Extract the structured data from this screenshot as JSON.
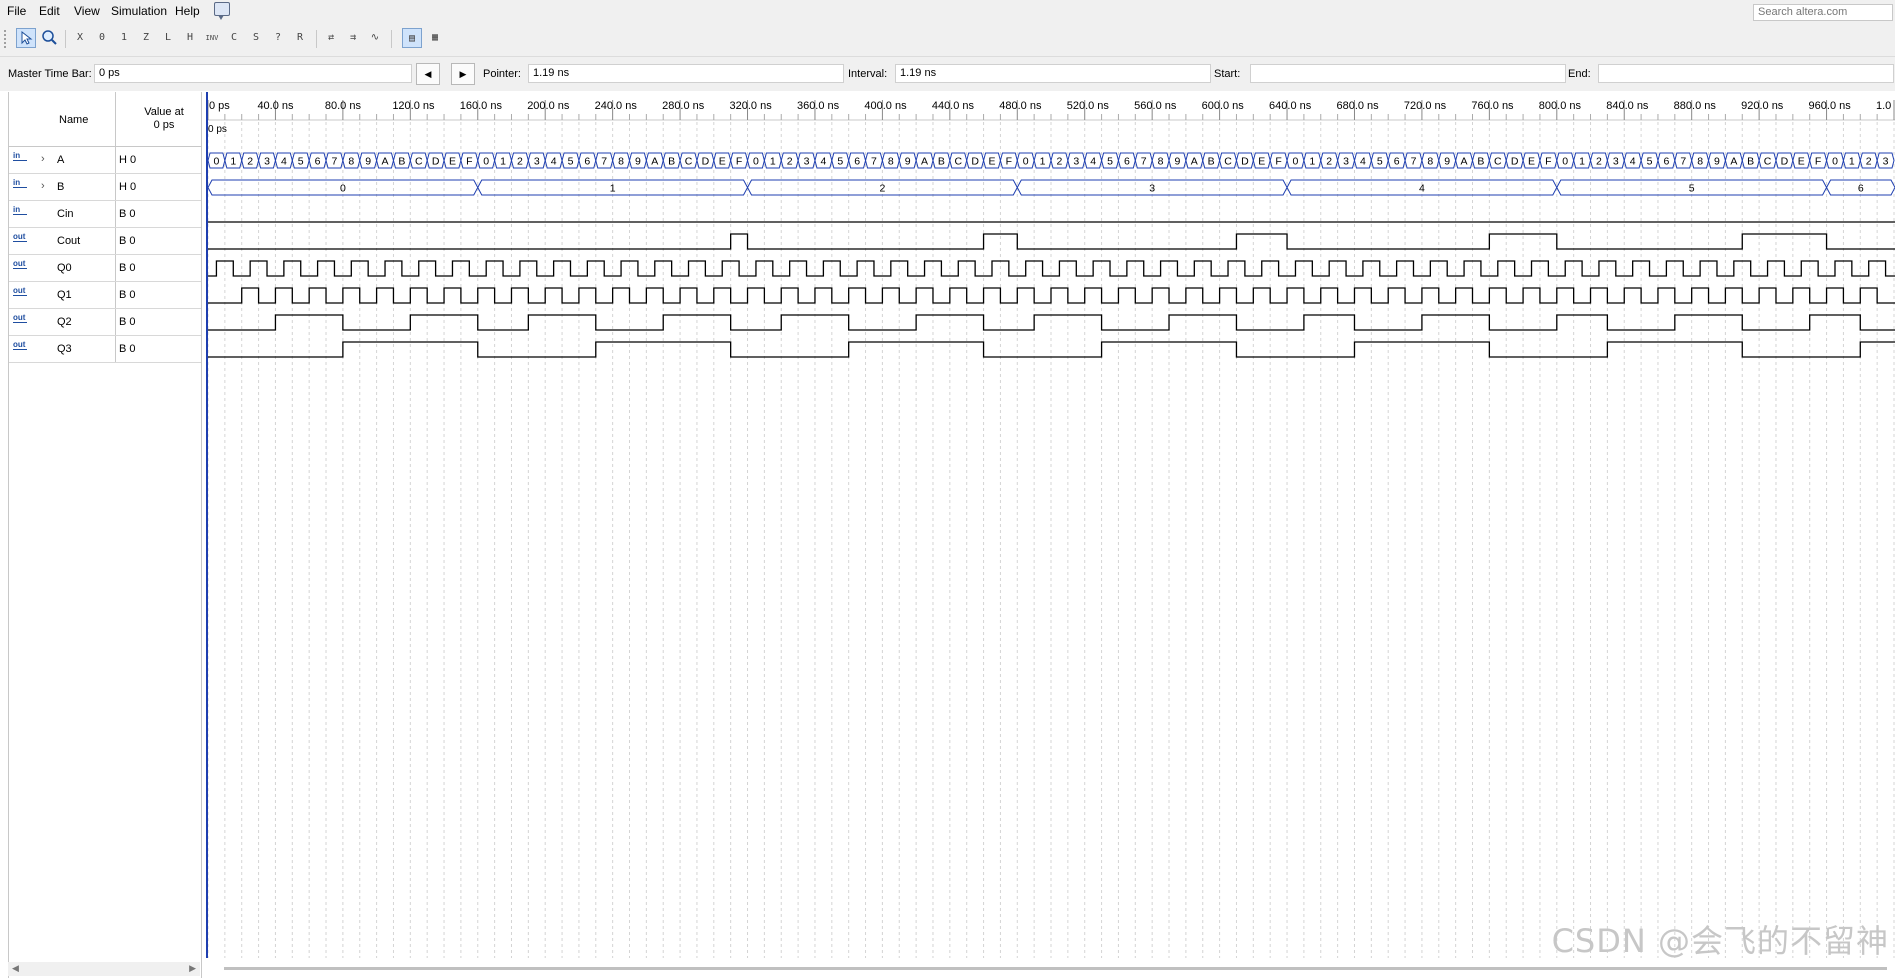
{
  "menu": {
    "file": "File",
    "edit": "Edit",
    "view": "View",
    "simulation": "Simulation",
    "help": "Help"
  },
  "search": {
    "placeholder": "Search altera.com"
  },
  "toolbar": {
    "buttons": [
      "selection-tool",
      "zoom-tool",
      "force-unknown",
      "force-low",
      "force-high",
      "force-high-impedance",
      "force-weak-low",
      "force-weak-high",
      "invert",
      "count-value",
      "clock",
      "random",
      "arbitrary-value",
      "snap-to-grid-1",
      "snap-to-grid-2",
      "snap-to-grid-3",
      "group-view",
      "grid-view"
    ]
  },
  "timebar": {
    "master_label": "Master Time Bar:",
    "master_value": "0 ps",
    "pointer_label": "Pointer:",
    "pointer_value": "1.19 ns",
    "interval_label": "Interval:",
    "interval_value": "1.19 ns",
    "start_label": "Start:",
    "start_value": "",
    "end_label": "End:",
    "end_value": ""
  },
  "columns": {
    "name": "Name",
    "value_at_line1": "Value at",
    "value_at_line2": "0 ps"
  },
  "signals": [
    {
      "dir": "in",
      "name": "A",
      "value": "H 0",
      "expandable": true,
      "type": "bus"
    },
    {
      "dir": "in",
      "name": "B",
      "value": "H 0",
      "expandable": true,
      "type": "bus"
    },
    {
      "dir": "in",
      "name": "Cin",
      "value": "B 0",
      "expandable": false,
      "type": "bit"
    },
    {
      "dir": "out",
      "name": "Cout",
      "value": "B 0",
      "expandable": false,
      "type": "bit"
    },
    {
      "dir": "out",
      "name": "Q0",
      "value": "B 0",
      "expandable": false,
      "type": "bit"
    },
    {
      "dir": "out",
      "name": "Q1",
      "value": "B 0",
      "expandable": false,
      "type": "bit"
    },
    {
      "dir": "out",
      "name": "Q2",
      "value": "B 0",
      "expandable": false,
      "type": "bit"
    },
    {
      "dir": "out",
      "name": "Q3",
      "value": "B 0",
      "expandable": false,
      "type": "bit"
    }
  ],
  "timeline": {
    "ticks": [
      "0 ps",
      "40.0 ns",
      "80.0 ns",
      "120.0 ns",
      "160.0 ns",
      "200.0 ns",
      "240.0 ns",
      "280.0 ns",
      "320.0 ns",
      "360.0 ns",
      "400.0 ns",
      "440.0 ns",
      "480.0 ns",
      "520.0 ns",
      "560.0 ns",
      "600.0 ns",
      "640.0 ns",
      "680.0 ns",
      "720.0 ns",
      "760.0 ns",
      "800.0 ns",
      "840.0 ns",
      "880.0 ns",
      "920.0 ns",
      "960.0 ns",
      "1.0 us"
    ],
    "cursor_label": "0 ps"
  },
  "waveforms": {
    "A_sequence": "0123456789ABCDEF",
    "A_period_ns": 10,
    "B_values": [
      "0",
      "1",
      "2",
      "3",
      "4",
      "5",
      "6"
    ],
    "B_period_ns": 160,
    "Cin": [
      [
        0,
        0
      ]
    ],
    "Cout": [
      [
        0,
        0
      ],
      [
        310,
        1
      ],
      [
        320,
        0
      ],
      [
        460,
        1
      ],
      [
        480,
        0
      ],
      [
        610,
        1
      ],
      [
        640,
        0
      ],
      [
        760,
        1
      ],
      [
        800,
        0
      ],
      [
        910,
        1
      ],
      [
        960,
        0
      ]
    ],
    "Q0": [
      [
        0,
        0
      ],
      [
        5,
        1
      ],
      [
        15,
        0
      ],
      [
        25,
        1
      ],
      [
        35,
        0
      ],
      [
        45,
        1
      ],
      [
        55,
        0
      ],
      [
        65,
        1
      ],
      [
        75,
        0
      ],
      [
        85,
        1
      ],
      [
        95,
        0
      ],
      [
        105,
        1
      ],
      [
        115,
        0
      ],
      [
        125,
        1
      ],
      [
        135,
        0
      ],
      [
        145,
        1
      ],
      [
        155,
        0
      ],
      [
        165,
        1
      ],
      [
        175,
        0
      ],
      [
        185,
        1
      ],
      [
        195,
        0
      ],
      [
        205,
        1
      ],
      [
        215,
        0
      ],
      [
        225,
        1
      ],
      [
        235,
        0
      ],
      [
        245,
        1
      ],
      [
        255,
        0
      ],
      [
        265,
        1
      ],
      [
        275,
        0
      ],
      [
        285,
        1
      ],
      [
        295,
        0
      ],
      [
        305,
        1
      ],
      [
        315,
        0
      ],
      [
        325,
        1
      ],
      [
        335,
        0
      ],
      [
        345,
        1
      ],
      [
        355,
        0
      ],
      [
        365,
        1
      ],
      [
        375,
        0
      ],
      [
        385,
        1
      ],
      [
        395,
        0
      ],
      [
        405,
        1
      ],
      [
        415,
        0
      ],
      [
        425,
        1
      ],
      [
        435,
        0
      ],
      [
        445,
        1
      ],
      [
        455,
        0
      ],
      [
        465,
        1
      ],
      [
        475,
        0
      ],
      [
        485,
        1
      ],
      [
        495,
        0
      ],
      [
        505,
        1
      ],
      [
        515,
        0
      ],
      [
        525,
        1
      ],
      [
        535,
        0
      ],
      [
        545,
        1
      ],
      [
        555,
        0
      ],
      [
        565,
        1
      ],
      [
        575,
        0
      ],
      [
        585,
        1
      ],
      [
        595,
        0
      ],
      [
        605,
        1
      ],
      [
        615,
        0
      ],
      [
        625,
        1
      ],
      [
        635,
        0
      ],
      [
        645,
        1
      ],
      [
        655,
        0
      ],
      [
        665,
        1
      ],
      [
        675,
        0
      ],
      [
        685,
        1
      ],
      [
        695,
        0
      ],
      [
        705,
        1
      ],
      [
        715,
        0
      ],
      [
        725,
        1
      ],
      [
        735,
        0
      ],
      [
        745,
        1
      ],
      [
        755,
        0
      ],
      [
        765,
        1
      ],
      [
        775,
        0
      ],
      [
        785,
        1
      ],
      [
        795,
        0
      ],
      [
        805,
        1
      ],
      [
        815,
        0
      ],
      [
        825,
        1
      ],
      [
        835,
        0
      ],
      [
        845,
        1
      ],
      [
        855,
        0
      ],
      [
        865,
        1
      ],
      [
        875,
        0
      ],
      [
        885,
        1
      ],
      [
        895,
        0
      ],
      [
        905,
        1
      ],
      [
        915,
        0
      ],
      [
        925,
        1
      ],
      [
        935,
        0
      ],
      [
        945,
        1
      ],
      [
        955,
        0
      ],
      [
        965,
        1
      ],
      [
        975,
        0
      ],
      [
        985,
        1
      ],
      [
        995,
        0
      ]
    ],
    "Q1": [
      [
        0,
        0
      ],
      [
        20,
        1
      ],
      [
        30,
        0
      ],
      [
        40,
        1
      ],
      [
        50,
        0
      ],
      [
        60,
        1
      ],
      [
        70,
        0
      ],
      [
        80,
        1
      ],
      [
        90,
        0
      ],
      [
        100,
        1
      ],
      [
        110,
        0
      ],
      [
        120,
        1
      ],
      [
        130,
        0
      ],
      [
        140,
        1
      ],
      [
        150,
        0
      ],
      [
        160,
        1
      ],
      [
        170,
        0
      ],
      [
        180,
        1
      ],
      [
        190,
        0
      ],
      [
        200,
        1
      ],
      [
        210,
        0
      ],
      [
        220,
        1
      ],
      [
        230,
        0
      ],
      [
        240,
        1
      ],
      [
        250,
        0
      ],
      [
        260,
        1
      ],
      [
        270,
        0
      ],
      [
        280,
        1
      ],
      [
        290,
        0
      ],
      [
        300,
        1
      ],
      [
        310,
        0
      ],
      [
        320,
        1
      ],
      [
        330,
        0
      ],
      [
        340,
        1
      ],
      [
        350,
        0
      ],
      [
        360,
        1
      ],
      [
        370,
        0
      ],
      [
        380,
        1
      ],
      [
        390,
        0
      ],
      [
        400,
        1
      ],
      [
        410,
        0
      ],
      [
        420,
        1
      ],
      [
        430,
        0
      ],
      [
        440,
        1
      ],
      [
        450,
        0
      ],
      [
        460,
        1
      ],
      [
        470,
        0
      ],
      [
        480,
        1
      ],
      [
        490,
        0
      ],
      [
        500,
        1
      ],
      [
        510,
        0
      ],
      [
        520,
        1
      ],
      [
        530,
        0
      ],
      [
        540,
        1
      ],
      [
        550,
        0
      ],
      [
        560,
        1
      ],
      [
        570,
        0
      ],
      [
        580,
        1
      ],
      [
        590,
        0
      ],
      [
        600,
        1
      ],
      [
        610,
        0
      ],
      [
        620,
        1
      ],
      [
        630,
        0
      ],
      [
        640,
        1
      ],
      [
        650,
        0
      ],
      [
        660,
        1
      ],
      [
        670,
        0
      ],
      [
        680,
        1
      ],
      [
        690,
        0
      ],
      [
        700,
        1
      ],
      [
        710,
        0
      ],
      [
        720,
        1
      ],
      [
        730,
        0
      ],
      [
        740,
        1
      ],
      [
        750,
        0
      ],
      [
        760,
        1
      ],
      [
        770,
        0
      ],
      [
        780,
        1
      ],
      [
        790,
        0
      ],
      [
        800,
        1
      ],
      [
        810,
        0
      ],
      [
        820,
        1
      ],
      [
        830,
        0
      ],
      [
        840,
        1
      ],
      [
        850,
        0
      ],
      [
        860,
        1
      ],
      [
        870,
        0
      ],
      [
        880,
        1
      ],
      [
        890,
        0
      ],
      [
        900,
        1
      ],
      [
        910,
        0
      ],
      [
        920,
        1
      ],
      [
        930,
        0
      ],
      [
        940,
        1
      ],
      [
        950,
        0
      ],
      [
        960,
        1
      ],
      [
        970,
        0
      ],
      [
        980,
        1
      ],
      [
        990,
        0
      ]
    ],
    "Q2": [
      [
        0,
        0
      ],
      [
        40,
        1
      ],
      [
        80,
        0
      ],
      [
        120,
        1
      ],
      [
        160,
        0
      ],
      [
        190,
        1
      ],
      [
        230,
        0
      ],
      [
        270,
        1
      ],
      [
        310,
        0
      ],
      [
        340,
        1
      ],
      [
        380,
        0
      ],
      [
        420,
        1
      ],
      [
        460,
        0
      ],
      [
        490,
        1
      ],
      [
        530,
        0
      ],
      [
        570,
        1
      ],
      [
        610,
        0
      ],
      [
        650,
        1
      ],
      [
        680,
        0
      ],
      [
        720,
        1
      ],
      [
        760,
        0
      ],
      [
        800,
        1
      ],
      [
        830,
        0
      ],
      [
        870,
        1
      ],
      [
        910,
        0
      ],
      [
        950,
        1
      ],
      [
        980,
        0
      ]
    ],
    "Q3": [
      [
        0,
        0
      ],
      [
        80,
        1
      ],
      [
        160,
        0
      ],
      [
        230,
        1
      ],
      [
        310,
        0
      ],
      [
        380,
        1
      ],
      [
        460,
        0
      ],
      [
        530,
        1
      ],
      [
        610,
        0
      ],
      [
        680,
        1
      ],
      [
        760,
        0
      ],
      [
        830,
        1
      ],
      [
        910,
        0
      ],
      [
        980,
        1
      ]
    ]
  },
  "watermark": "CSDN @会飞的不留神"
}
